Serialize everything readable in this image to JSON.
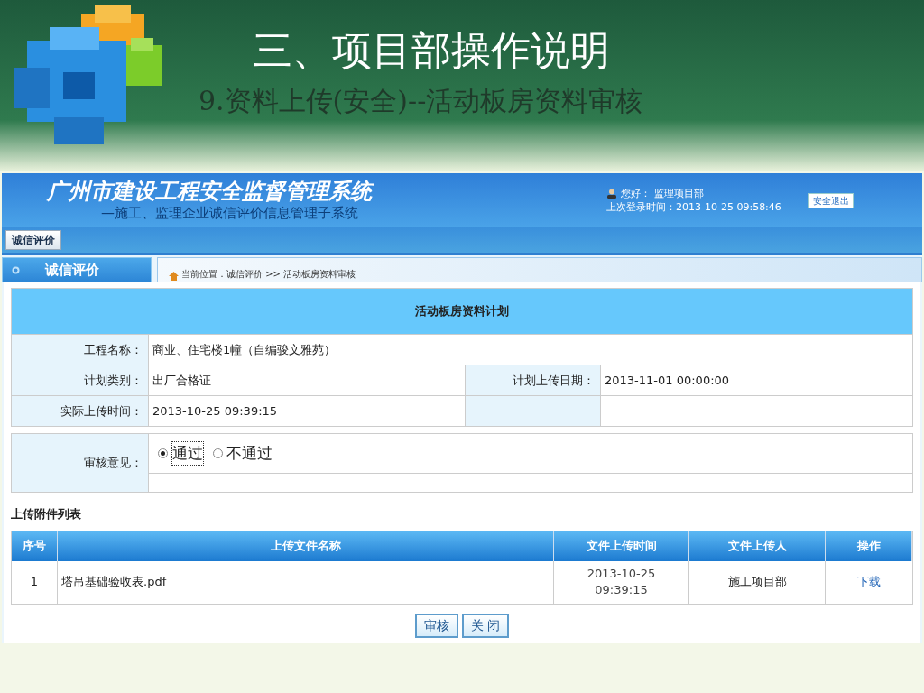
{
  "slide": {
    "title": "三、项目部操作说明",
    "subtitle": "9.资料上传(安全)--活动板房资料审核"
  },
  "app": {
    "system_title": "广州市建设工程安全监督管理系统",
    "system_subtitle": "—施工、监理企业诚信评价信息管理子系统",
    "greeting": "您好：",
    "user": "监理项目部",
    "last_login": "上次登录时间：2013-10-25 09:58:46",
    "logout": "安全退出",
    "nav_tabs": [
      {
        "label": "诚信评价",
        "selected": true
      }
    ],
    "sidebar": {
      "heading": "诚信评价"
    },
    "breadcrumb": "当前位置：诚信评价 >> 活动板房资料审核",
    "plan": {
      "title": "活动板房资料计划",
      "rows": [
        [
          {
            "label": "工程名称：",
            "value": "商业、住宅楼1幢（自编骏文雅苑）"
          }
        ],
        [
          {
            "label": "计划类别：",
            "value": "出厂合格证"
          },
          {
            "label": "计划上传日期：",
            "value": "2013-11-01 00:00:00"
          }
        ],
        [
          {
            "label": "实际上传时间：",
            "value": "2013-10-25 09:39:15"
          },
          {}
        ]
      ]
    },
    "review": {
      "label": "审核意见：",
      "options": [
        {
          "label": "通过",
          "selected": true
        },
        {
          "label": "不通过",
          "selected": false
        }
      ]
    },
    "attachments": {
      "title": "上传附件列表",
      "columns": [
        "序号",
        "上传文件名称",
        "文件上传时间",
        "文件上传人",
        "操作"
      ],
      "rows": [
        {
          "index": "1",
          "file": "塔吊基础验收表.pdf",
          "time": "2013-10-25 09:39:15",
          "uploader": "施工项目部",
          "action": "下载"
        }
      ]
    },
    "buttons": [
      "审核",
      "关 闭"
    ]
  }
}
